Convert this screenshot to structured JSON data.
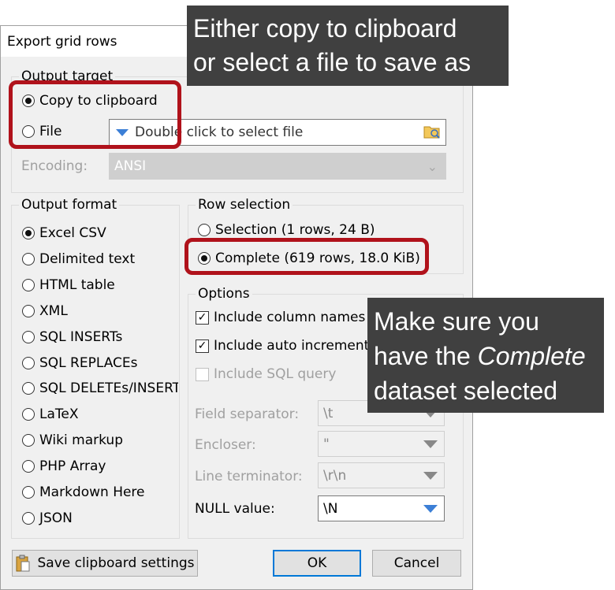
{
  "window": {
    "title": "Export grid rows"
  },
  "output_target": {
    "legend": "Output target",
    "copy_label": "Copy to clipboard",
    "file_label": "File",
    "file_placeholder": "Double click to select file",
    "encoding_label": "Encoding:",
    "encoding_value": "ANSI",
    "selected": "Copy to clipboard"
  },
  "output_format": {
    "legend": "Output format",
    "items": [
      "Excel CSV",
      "Delimited text",
      "HTML table",
      "XML",
      "SQL INSERTs",
      "SQL REPLACEs",
      "SQL DELETEs/INSERTs",
      "LaTeX",
      "Wiki markup",
      "PHP Array",
      "Markdown Here",
      "JSON"
    ],
    "selected": "Excel CSV"
  },
  "row_selection": {
    "legend": "Row selection",
    "selection_label": "Selection (1 rows, 24 B)",
    "complete_label": "Complete (619 rows, 18.0 KiB)",
    "selected": "Complete (619 rows, 18.0 KiB)"
  },
  "options": {
    "legend": "Options",
    "include_column_names": {
      "label": "Include column names",
      "checked": true
    },
    "include_auto_increment": {
      "label": "Include auto increment column",
      "checked": true
    },
    "include_sql_query": {
      "label": "Include SQL query",
      "checked": false
    },
    "field_separator": {
      "label": "Field separator:",
      "value": "\\t"
    },
    "encloser": {
      "label": "Encloser:",
      "value": "\""
    },
    "line_terminator": {
      "label": "Line terminator:",
      "value": "\\r\\n"
    },
    "null_value": {
      "label": "NULL value:",
      "value": "\\N"
    }
  },
  "buttons": {
    "save_settings": "Save clipboard settings",
    "ok": "OK",
    "cancel": "Cancel"
  },
  "annotations": {
    "callout_top_line1": "Either copy to clipboard",
    "callout_top_line2": "or select a file to save as",
    "callout_mid_line1": "Make sure you",
    "callout_mid_line2_pre": "have the ",
    "callout_mid_line2_em": "Complete",
    "callout_mid_line3": "dataset selected",
    "highlight_color": "#b0121b"
  }
}
